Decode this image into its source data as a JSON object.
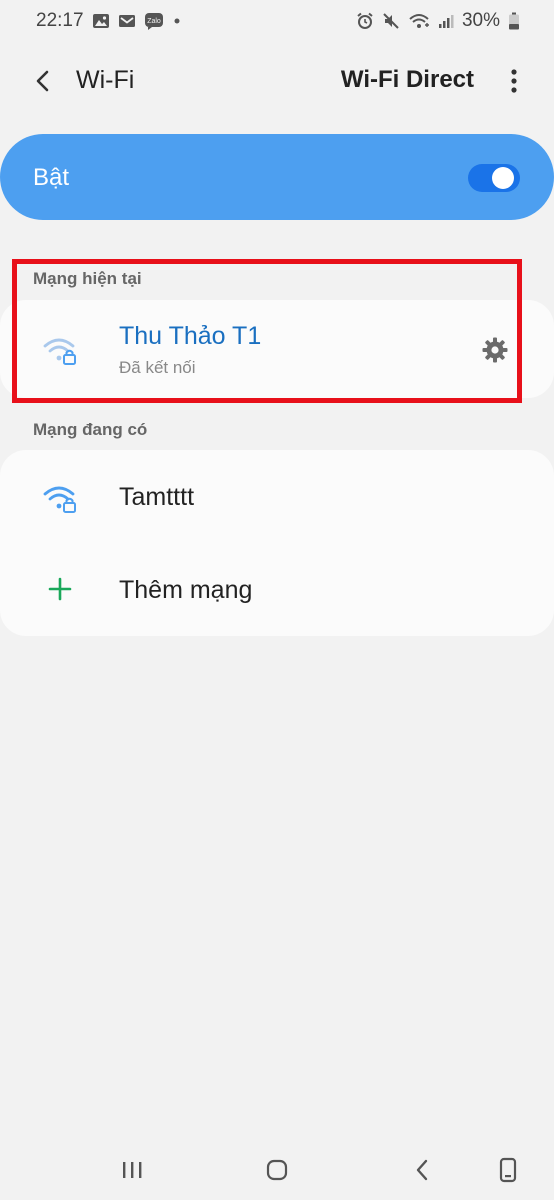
{
  "status_bar": {
    "time": "22:17",
    "battery": "30%",
    "left_icons": [
      "gallery-icon",
      "gmail-icon",
      "zalo-icon",
      "dot-icon"
    ],
    "zalo_text": "Zalo",
    "right_icons": [
      "alarm-icon",
      "mute-icon",
      "wifi-status-icon",
      "signal-icon",
      "battery-icon"
    ]
  },
  "header": {
    "back_icon": "chevron-left-icon",
    "title": "Wi-Fi",
    "wifi_direct_label": "Wi-Fi Direct",
    "more_icon": "more-vertical-icon"
  },
  "master_switch": {
    "label": "Bật",
    "on": true,
    "accent": "#4d9ff0",
    "track_color": "#1a73e8"
  },
  "current_network": {
    "header": "Mạng hiện tại",
    "name": "Thu Thảo T1",
    "status": "Đã kết nối",
    "name_color": "#1a6fc0",
    "icon": "wifi-lock-icon",
    "settings_icon": "gear-icon"
  },
  "available_networks": {
    "header": "Mạng đang có",
    "items": [
      {
        "name": "Tamtttt",
        "icon": "wifi-lock-icon"
      }
    ],
    "add_label": "Thêm mạng",
    "add_icon": "plus-icon",
    "add_color": "#1aa85a"
  },
  "annotation": {
    "highlight_color": "#e8101a"
  },
  "nav_bar": {
    "icons": [
      "recents-icon",
      "home-icon",
      "back-icon",
      "keyboard-icon"
    ]
  }
}
